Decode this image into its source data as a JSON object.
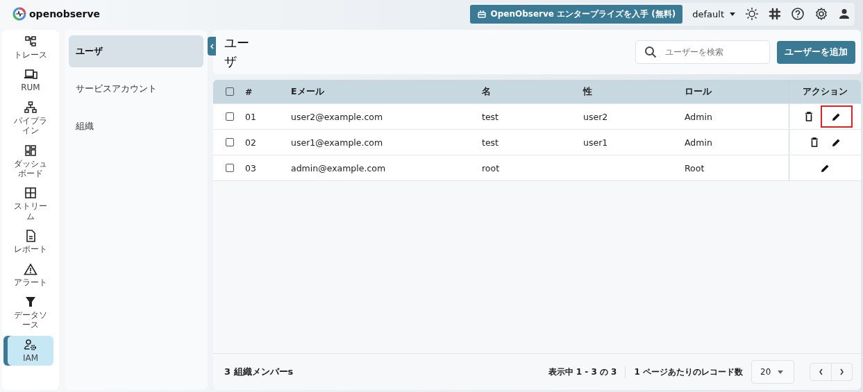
{
  "header": {
    "logo": "openobserve",
    "enterprise_button": "OpenObserve エンタープライズを入手 (無料)",
    "org_selector": "default"
  },
  "nav": [
    {
      "label": "トレース",
      "kind": "trace",
      "selected": false
    },
    {
      "label": "RUM",
      "kind": "rum",
      "selected": false
    },
    {
      "label": "パイプライン",
      "kind": "pipeline",
      "selected": false
    },
    {
      "label": "ダッシュボード",
      "kind": "dashboard",
      "selected": false
    },
    {
      "label": "ストリーム",
      "kind": "stream",
      "selected": false
    },
    {
      "label": "レポート",
      "kind": "report",
      "selected": false
    },
    {
      "label": "アラート",
      "kind": "alert",
      "selected": false
    },
    {
      "label": "データソース",
      "kind": "datasource",
      "selected": false
    },
    {
      "label": "IAM",
      "kind": "iam",
      "selected": true
    }
  ],
  "submenu": [
    {
      "label": "ユーザ",
      "selected": true
    },
    {
      "label": "サービスアカウント",
      "selected": false
    },
    {
      "label": "組織",
      "selected": false
    }
  ],
  "page": {
    "title": "ユーザ",
    "search": {
      "placeholder": "ユーザーを検索"
    },
    "add_button": "ユーザーを追加"
  },
  "table": {
    "header_checked": false,
    "columns": [
      "#",
      "Eメール",
      "名",
      "性",
      "ロール",
      "アクション"
    ],
    "rows": [
      {
        "checked": false,
        "cells": [
          "01",
          "user2@example.com",
          "test",
          "user2",
          "Admin"
        ],
        "can_delete": true,
        "edit_highlighted": true
      },
      {
        "checked": false,
        "cells": [
          "02",
          "user1@example.com",
          "test",
          "user1",
          "Admin"
        ],
        "can_delete": true,
        "edit_highlighted": false
      },
      {
        "checked": false,
        "cells": [
          "03",
          "admin@example.com",
          "root",
          "",
          "Root"
        ],
        "can_delete": false,
        "edit_highlighted": false
      }
    ]
  },
  "footer": {
    "count": "3 組織メンバーs",
    "range": "表示中 1 - 3 の 3",
    "per_page_label": "1 ページあたりのレコード数",
    "per_page": "20"
  }
}
